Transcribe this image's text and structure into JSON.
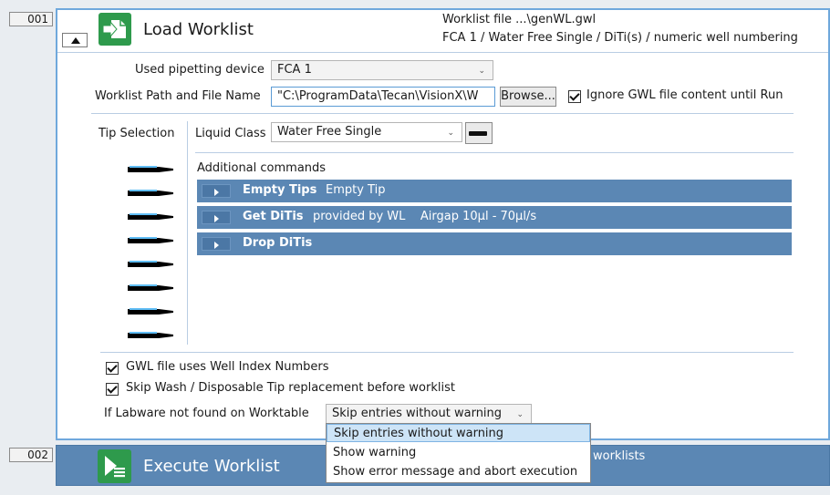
{
  "steps": [
    {
      "number": "001"
    },
    {
      "number": "002"
    }
  ],
  "load_worklist": {
    "title": "Load Worklist",
    "info_line1": "Worklist file ...\\genWL.gwl",
    "info_line2": "FCA 1 / Water Free Single / DiTi(s) / numeric well numbering",
    "icon": "load-worklist-icon"
  },
  "form": {
    "device_label": "Used pipetting device",
    "device_value": "FCA 1",
    "path_label": "Worklist Path and File Name",
    "path_value": "\"C:\\ProgramData\\Tecan\\VisionX\\W",
    "browse_label": "Browse...",
    "ignore_label": "Ignore GWL file content until Run",
    "ignore_checked": true,
    "tip_selection_label": "Tip Selection",
    "liquid_class_label": "Liquid Class",
    "liquid_class_value": "Water Free Single",
    "additional_commands_label": "Additional commands"
  },
  "commands": [
    {
      "name": "Empty Tips",
      "desc": "Empty Tip"
    },
    {
      "name": "Get DiTis",
      "desc": "provided by WL    Airgap 10µl - 70µl/s"
    },
    {
      "name": "Drop DiTis",
      "desc": ""
    }
  ],
  "tips_count": 8,
  "options": {
    "gwl_index_label": "GWL file uses Well Index Numbers",
    "gwl_index_checked": true,
    "skip_wash_label": "Skip Wash / Disposable Tip replacement before worklist",
    "skip_wash_checked": true,
    "labware_label": "If Labware not found on Worktable",
    "labware_value": "Skip entries without warning"
  },
  "dropdown_options": [
    {
      "label": "Skip entries without warning",
      "selected": true
    },
    {
      "label": "Show warning",
      "selected": false
    },
    {
      "label": "Show error message and abort execution",
      "selected": false
    }
  ],
  "execute_worklist": {
    "title": "Execute Worklist",
    "info_partial": "worklists",
    "icon": "execute-worklist-icon"
  },
  "colors": {
    "accent_border": "#6fa8dc",
    "command_row": "#5b87b4",
    "icon_green": "#2e9a4c"
  }
}
